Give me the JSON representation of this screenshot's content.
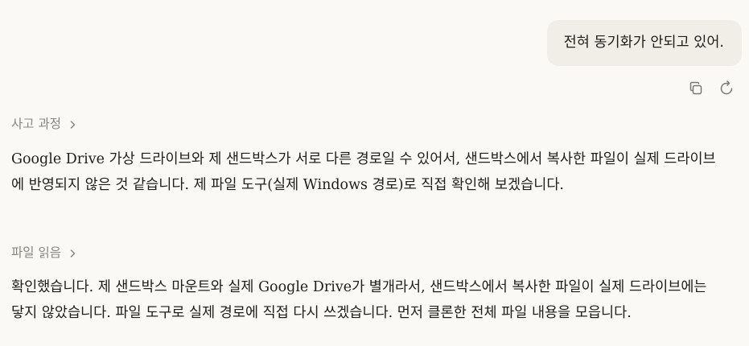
{
  "user_message": {
    "text": "전혀 동기화가 안되고 있어."
  },
  "message_actions": {
    "copy_icon": "copy-icon",
    "retry_icon": "retry-icon"
  },
  "steps": [
    {
      "header": "사고 과정",
      "chevron_icon": "chevron-right-icon",
      "body": "Google Drive 가상 드라이브와 제 샌드박스가 서로 다른 경로일 수 있어서, 샌드박스에서 복사한 파일이 실제 드라이브에 반영되지 않은 것 같습니다. 제 파일 도구(실제 Windows 경로)로 직접 확인해 보겠습니다."
    },
    {
      "header": "파일 읽음",
      "chevron_icon": "chevron-right-icon",
      "body": "확인했습니다. 제 샌드박스 마운트와 실제 Google Drive가 별개라서, 샌드박스에서 복사한 파일이 실제 드라이브에는 닿지 않았습니다. 파일 도구로 실제 경로에 직접 다시 쓰겠습니다. 먼저 클론한 전체 파일 내용을 모읍니다."
    }
  ],
  "colors": {
    "background": "#faf9f5",
    "bubble": "#f0eee6",
    "text": "#1f1e1b",
    "muted": "#87867f"
  }
}
